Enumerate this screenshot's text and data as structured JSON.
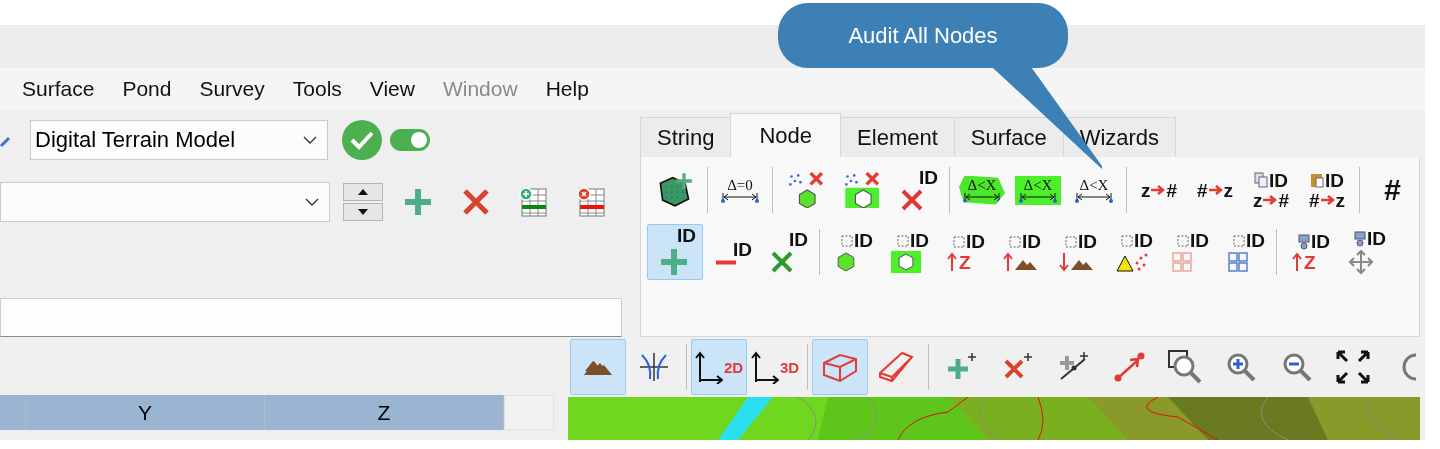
{
  "callout": {
    "text": "Audit All Nodes"
  },
  "menu": [
    {
      "label": "Surface",
      "disabled": false
    },
    {
      "label": "Pond",
      "disabled": false
    },
    {
      "label": "Survey",
      "disabled": false
    },
    {
      "label": "Tools",
      "disabled": false
    },
    {
      "label": "View",
      "disabled": false
    },
    {
      "label": "Window",
      "disabled": true
    },
    {
      "label": "Help",
      "disabled": false
    }
  ],
  "model_select": {
    "value": "Digital Terrain Model"
  },
  "model_toggle": {
    "on": true
  },
  "left_toolbar": [
    {
      "kind": "plus"
    },
    {
      "kind": "cross"
    },
    {
      "kind": "table-add"
    },
    {
      "kind": "table-remove"
    }
  ],
  "tabs": [
    {
      "label": "String",
      "selected": false
    },
    {
      "label": "Node",
      "selected": true
    },
    {
      "label": "Element",
      "selected": false
    },
    {
      "label": "Surface",
      "selected": false
    },
    {
      "label": "Wizards",
      "selected": false
    }
  ],
  "ribbon_rows": [
    [
      [
        {
          "kind": "polygon-add",
          "selected": false
        }
      ],
      [
        {
          "kind": "delta-zero",
          "label": "Δ=0",
          "selected": false
        }
      ],
      [
        {
          "kind": "delete-points-polygon",
          "selected": false
        },
        {
          "kind": "delete-points-box",
          "selected": false
        },
        {
          "kind": "id-delete",
          "label": "ID",
          "selected": false
        }
      ],
      [
        {
          "kind": "delta-blob",
          "label": "Δ<X",
          "selected": false
        },
        {
          "kind": "delta-box",
          "label": "Δ<X",
          "selected": false
        },
        {
          "kind": "delta-plain",
          "label": "Δ<X",
          "selected": false
        }
      ],
      [
        {
          "kind": "convert",
          "from": "z",
          "to": "#",
          "selected": false
        },
        {
          "kind": "convert",
          "from": "#",
          "to": "z",
          "selected": false
        },
        {
          "kind": "copy-convert",
          "label": "ID",
          "from": "z",
          "to": "#",
          "selected": false
        },
        {
          "kind": "paste-convert",
          "label": "ID",
          "from": "#",
          "to": "z",
          "selected": false
        }
      ],
      [
        {
          "kind": "symbol",
          "label": "#",
          "selected": false
        }
      ]
    ],
    [
      [
        {
          "kind": "id-add",
          "label": "ID",
          "selected": true
        },
        {
          "kind": "id-remove",
          "label": "ID",
          "selected": false
        },
        {
          "kind": "id-clear",
          "label": "ID",
          "selected": false
        }
      ],
      [
        {
          "kind": "id-polygon",
          "label": "ID",
          "selected": false
        },
        {
          "kind": "id-box",
          "label": "ID",
          "selected": false
        },
        {
          "kind": "id-raise",
          "label": "ID",
          "sub": "Z",
          "selected": false
        },
        {
          "kind": "id-terrain-up",
          "label": "ID",
          "selected": false
        },
        {
          "kind": "id-terrain-down",
          "label": "ID",
          "selected": false
        },
        {
          "kind": "id-triangle",
          "label": "ID",
          "selected": false
        },
        {
          "kind": "id-grid-partial",
          "label": "ID",
          "selected": false
        },
        {
          "kind": "id-grid-full",
          "label": "ID",
          "selected": false
        }
      ],
      [
        {
          "kind": "node-raise",
          "label": "ID",
          "sub": "Z",
          "selected": false
        },
        {
          "kind": "node-move",
          "label": "ID",
          "selected": false
        }
      ]
    ]
  ],
  "view_toolbar": [
    [
      {
        "kind": "terrain",
        "selected": true
      },
      {
        "kind": "intersect",
        "selected": false
      }
    ],
    [
      {
        "kind": "axes",
        "label": "2D",
        "selected": true
      },
      {
        "kind": "axes",
        "label": "3D",
        "selected": false
      }
    ],
    [
      {
        "kind": "box",
        "selected": true
      },
      {
        "kind": "wedge",
        "selected": false
      }
    ],
    [
      {
        "kind": "add-plus",
        "selected": false
      },
      {
        "kind": "delete-plus",
        "selected": false
      },
      {
        "kind": "line-plus",
        "selected": false
      },
      {
        "kind": "arrow-points",
        "selected": false
      },
      {
        "kind": "zoom-window",
        "selected": false
      },
      {
        "kind": "zoom-in",
        "selected": false
      },
      {
        "kind": "zoom-out",
        "selected": false
      },
      {
        "kind": "extents",
        "selected": false
      },
      {
        "kind": "refresh",
        "selected": false
      }
    ]
  ],
  "table": {
    "columns": [
      {
        "label": "Y"
      },
      {
        "label": "Z"
      }
    ]
  },
  "map": {
    "kind": "picture"
  }
}
